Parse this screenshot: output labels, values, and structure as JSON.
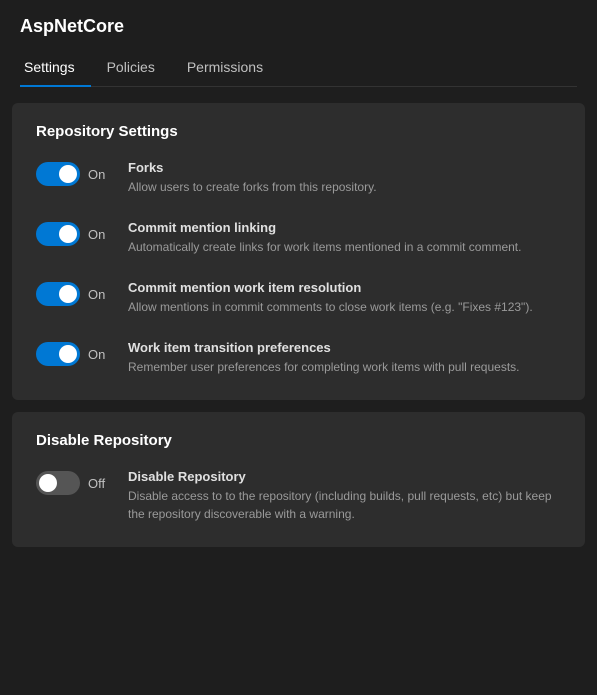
{
  "app": {
    "title": "AspNetCore"
  },
  "tabs": [
    {
      "id": "settings",
      "label": "Settings",
      "active": true
    },
    {
      "id": "policies",
      "label": "Policies",
      "active": false
    },
    {
      "id": "permissions",
      "label": "Permissions",
      "active": false
    }
  ],
  "sections": [
    {
      "id": "repo-settings",
      "title": "Repository Settings",
      "settings": [
        {
          "id": "forks",
          "name": "Forks",
          "description": "Allow users to create forks from this repository.",
          "enabled": true,
          "toggleLabel": "On"
        },
        {
          "id": "commit-mention-linking",
          "name": "Commit mention linking",
          "description": "Automatically create links for work items mentioned in a commit comment.",
          "enabled": true,
          "toggleLabel": "On"
        },
        {
          "id": "commit-mention-resolution",
          "name": "Commit mention work item resolution",
          "description": "Allow mentions in commit comments to close work items (e.g. \"Fixes #123\").",
          "enabled": true,
          "toggleLabel": "On"
        },
        {
          "id": "work-item-transition",
          "name": "Work item transition preferences",
          "description": "Remember user preferences for completing work items with pull requests.",
          "enabled": true,
          "toggleLabel": "On"
        }
      ]
    },
    {
      "id": "disable-repo",
      "title": "Disable Repository",
      "settings": [
        {
          "id": "disable-repository",
          "name": "Disable Repository",
          "description": "Disable access to to the repository (including builds, pull requests, etc) but keep the repository discoverable with a warning.",
          "enabled": false,
          "toggleLabel": "Off"
        }
      ]
    }
  ]
}
